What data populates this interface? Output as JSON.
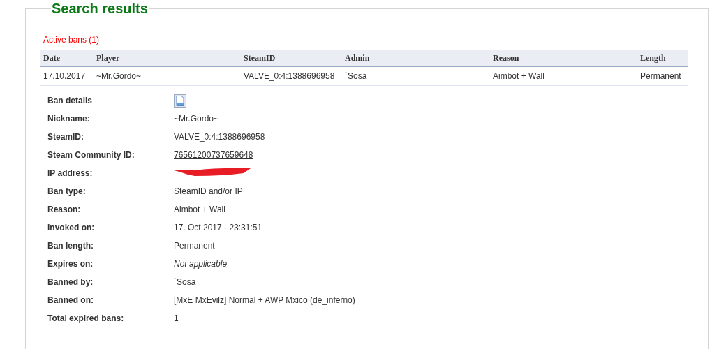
{
  "panel": {
    "title": "Search results"
  },
  "active_bans": {
    "heading": "Active bans (1)",
    "columns": [
      "Date",
      "Player",
      "SteamID",
      "Admin",
      "Reason",
      "Length"
    ],
    "rows": [
      [
        "17.10.2017",
        "~Mr.Gordo~",
        "VALVE_0:4:1388696958",
        "`Sosa",
        "Aimbot + Wall",
        "Permanent"
      ]
    ]
  },
  "details": [
    {
      "label": "Ban details",
      "kind": "icon"
    },
    {
      "label": "Nickname:",
      "kind": "text",
      "value": "~Mr.Gordo~"
    },
    {
      "label": "SteamID:",
      "kind": "text",
      "value": "VALVE_0:4:1388696958"
    },
    {
      "label": "Steam Community ID:",
      "kind": "link",
      "value": "76561200737659648"
    },
    {
      "label": "IP address:",
      "kind": "redacted"
    },
    {
      "label": "Ban type:",
      "kind": "text",
      "value": "SteamID and/or IP"
    },
    {
      "label": "Reason:",
      "kind": "text",
      "value": "Aimbot + Wall"
    },
    {
      "label": "Invoked on:",
      "kind": "text",
      "value": "17. Oct 2017 - 23:31:51"
    },
    {
      "label": "Ban length:",
      "kind": "text",
      "value": "Permanent"
    },
    {
      "label": "Expires on:",
      "kind": "italic",
      "value": "Not applicable"
    },
    {
      "label": "Banned by:",
      "kind": "text",
      "value": "`Sosa"
    },
    {
      "label": "Banned on:",
      "kind": "text",
      "value": "[MxE MxEvilz] Normal + AWP Mxico (de_inferno)"
    },
    {
      "label": "Total expired bans:",
      "kind": "text",
      "value": "1"
    }
  ]
}
